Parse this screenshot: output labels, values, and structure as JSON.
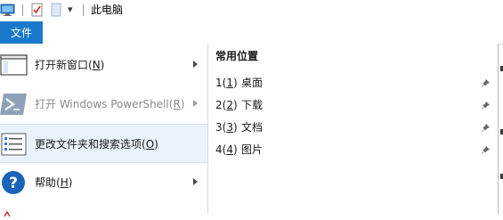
{
  "window": {
    "title": "此电脑",
    "qat_dropdown": "▾"
  },
  "ribbon": {
    "file_tab_label": "文件"
  },
  "menu": {
    "items": [
      {
        "label": "打开新窗口(",
        "hotkey": "N",
        "suffix": ")",
        "has_submenu": true,
        "enabled": true,
        "icon": "new-window-icon"
      },
      {
        "label": "打开 Windows PowerShell(",
        "hotkey": "R",
        "suffix": ")",
        "has_submenu": true,
        "enabled": false,
        "icon": "powershell-icon"
      },
      {
        "label": "更改文件夹和搜索选项(",
        "hotkey": "O",
        "suffix": ")",
        "has_submenu": false,
        "enabled": true,
        "icon": "folder-options-icon"
      },
      {
        "label": "帮助(",
        "hotkey": "H",
        "suffix": ")",
        "has_submenu": true,
        "enabled": true,
        "icon": "help-icon"
      }
    ]
  },
  "frequent_places": {
    "heading": "常用位置",
    "items": [
      {
        "num": "1(",
        "num_key": "1",
        "num_suffix": ")",
        "name": "桌面"
      },
      {
        "num": "2(",
        "num_key": "2",
        "num_suffix": ")",
        "name": "下载"
      },
      {
        "num": "3(",
        "num_key": "3",
        "num_suffix": ")",
        "name": "文档"
      },
      {
        "num": "4(",
        "num_key": "4",
        "num_suffix": ")",
        "name": "图片"
      }
    ]
  },
  "colors": {
    "accent": "#1979ca",
    "selected_bg": "#eaf3fb"
  }
}
